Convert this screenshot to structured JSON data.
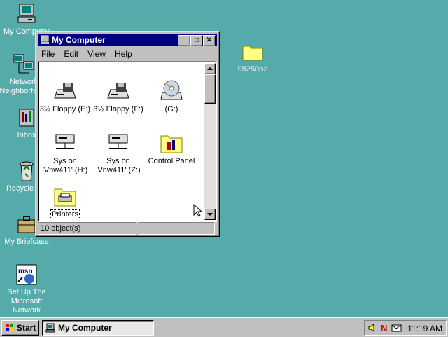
{
  "desktop": {
    "icons": [
      {
        "label": "My Computer",
        "icon": "my-computer-icon"
      },
      {
        "label": "Network Neighborhood",
        "icon": "network-neighborhood-icon"
      },
      {
        "label": "Inbox",
        "icon": "inbox-icon"
      },
      {
        "label": "Recycle Bin",
        "icon": "recycle-bin-icon"
      },
      {
        "label": "My Briefcase",
        "icon": "briefcase-icon"
      },
      {
        "label": "Set Up The Microsoft Network",
        "icon": "msn-icon"
      },
      {
        "label": "95250p2",
        "icon": "folder-icon"
      }
    ]
  },
  "window": {
    "title": "My Computer",
    "menu": [
      "File",
      "Edit",
      "View",
      "Help"
    ],
    "items": [
      {
        "label": "3½ Floppy (E:)",
        "icon": "floppy-drive-icon"
      },
      {
        "label": "3½ Floppy (F:)",
        "icon": "floppy-drive-icon"
      },
      {
        "label": "(G:)",
        "icon": "cd-drive-icon"
      },
      {
        "label": "Sys on 'Vnw411' (H:)",
        "icon": "network-drive-icon"
      },
      {
        "label": "Sys on 'Vnw411' (Z:)",
        "icon": "network-drive-icon"
      },
      {
        "label": "Control Panel",
        "icon": "control-panel-icon"
      },
      {
        "label": "Printers",
        "icon": "printers-icon"
      }
    ],
    "status": "10 object(s)",
    "buttons": {
      "minimize": "_",
      "maximize": "□",
      "close": "✕"
    }
  },
  "taskbar": {
    "start_label": "Start",
    "task_label": "My Computer",
    "clock": "11:19 AM"
  }
}
